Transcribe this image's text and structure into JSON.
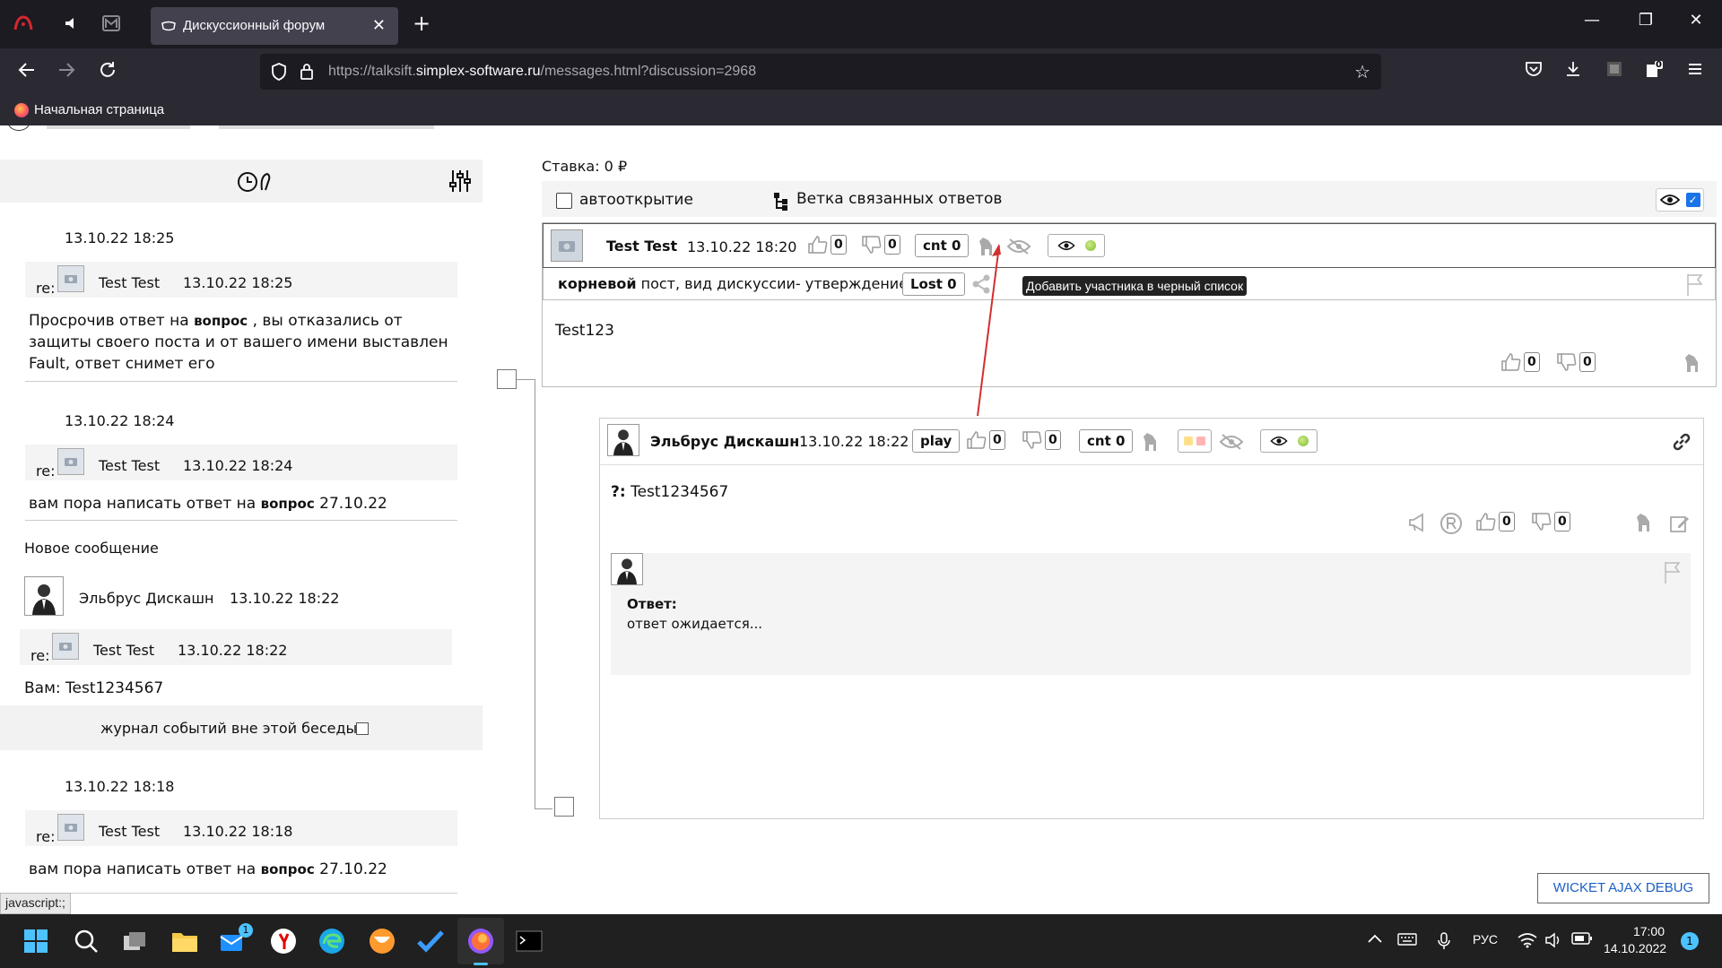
{
  "browser": {
    "tab_title": "Дискуссионный форум",
    "tab_close": "✕",
    "new_tab": "+",
    "url_prefix": "https://talksift.",
    "url_domain": "simplex-software.ru",
    "url_path": "/messages.html?discussion=2968",
    "bookmark_home": "Начальная страница",
    "extension_badge": "0",
    "win_minimize": "—",
    "win_restore": "❐",
    "win_close": "✕"
  },
  "left_panel": {
    "entries": [
      {
        "date": "13.10.22 18:25",
        "re_label": "re:",
        "re_name": "Test Test",
        "re_time": "13.10.22 18:25",
        "msg_before": "Просрочив ответ на ",
        "msg_bold": "вопрос",
        "msg_after": " , вы отказались от защиты своего поста и от вашего имени выставлен Fault, ответ снимет его"
      },
      {
        "date": "13.10.22 18:24",
        "re_label": "re:",
        "re_name": "Test Test",
        "re_time": "13.10.22 18:24",
        "msg_before": "вам пора написать ответ на ",
        "msg_bold": "вопрос",
        "msg_after": " 27.10.22"
      }
    ],
    "new_message": {
      "label": "Новое сообщение",
      "author": "Эльбрус Дискашн",
      "time": "13.10.22 18:22",
      "re_label": "re:",
      "re_name": "Test Test",
      "re_time": "13.10.22 18:22",
      "msg": "Вам: Test1234567"
    },
    "journal_label": "журнал событий вне этой беседы",
    "entry_last": {
      "date": "13.10.22 18:18",
      "re_label": "re:",
      "re_name": "Test Test",
      "re_time": "13.10.22 18:18",
      "msg_before": "вам пора написать ответ на ",
      "msg_bold": "вопрос",
      "msg_after": " 27.10.22"
    }
  },
  "main": {
    "stake": "Ставка: 0 ₽",
    "autoopen_label": "автооткрытие",
    "tree_label": "Ветка связанных ответов",
    "root_post": {
      "author": "Test Test",
      "time": "13.10.22 18:20",
      "likes": "0",
      "dislikes": "0",
      "cnt": "cnt 0",
      "type_bold": "корневой",
      "type_rest": " пост, вид дискуссии- утверждение",
      "lost": "Lost 0",
      "body": "Test123",
      "body_likes": "0",
      "body_dislikes": "0"
    },
    "tooltip": "Добавить участника в черный список",
    "reply_post": {
      "author": "Эльбрус Дискашн",
      "time": "13.10.22 18:22",
      "play": "play",
      "likes": "0",
      "dislikes": "0",
      "cnt": "cnt 0",
      "body_prefix": "?:",
      "body": " Test1234567",
      "body_likes": "0",
      "body_dislikes": "0",
      "answer_label": "Ответ:",
      "answer_text": "ответ ожидается..."
    },
    "debug_button": "WICKET AJAX DEBUG",
    "status_text": "javascript:;"
  },
  "taskbar": {
    "mail_badge": "1",
    "lang": "РУС",
    "time": "17:00",
    "date": "14.10.2022",
    "notif_count": "1"
  },
  "colors": {
    "chrome_dark": "#1c1b22",
    "chrome_nav": "#2b2a33",
    "accent": "#1a73e8",
    "tooltip_arrow": "#d32f2f"
  }
}
